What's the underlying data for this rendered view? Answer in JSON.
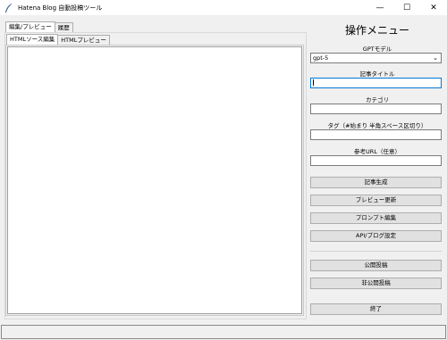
{
  "window": {
    "title": "Hatena Blog 自動投稿ツール",
    "minimize": "—",
    "maximize": "☐",
    "close": "✕"
  },
  "outer_tabs": [
    {
      "label": "編集/プレビュー",
      "active": true
    },
    {
      "label": "履歴",
      "active": false
    }
  ],
  "inner_tabs": [
    {
      "label": "HTMLソース編集",
      "active": true
    },
    {
      "label": "HTMLプレビュー",
      "active": false
    }
  ],
  "editor": {
    "value": ""
  },
  "menu": {
    "title": "操作メニュー",
    "model_label": "GPTモデル",
    "model_value": "gpt-5",
    "article_title_label": "記事タイトル",
    "article_title_value": "",
    "category_label": "カテゴリ",
    "category_value": "",
    "tags_label": "タグ（#始まり 半角スペース区切り）",
    "tags_value": "",
    "ref_url_label": "参考URL（任意）",
    "ref_url_value": "",
    "buttons": {
      "generate": "記事生成",
      "preview_update": "プレビュー更新",
      "prompt_edit": "プロンプト編集",
      "api_settings": "API/ブログ設定",
      "publish": "公開投稿",
      "draft": "非公開投稿",
      "exit": "終了"
    }
  },
  "status": {
    "text": ""
  }
}
